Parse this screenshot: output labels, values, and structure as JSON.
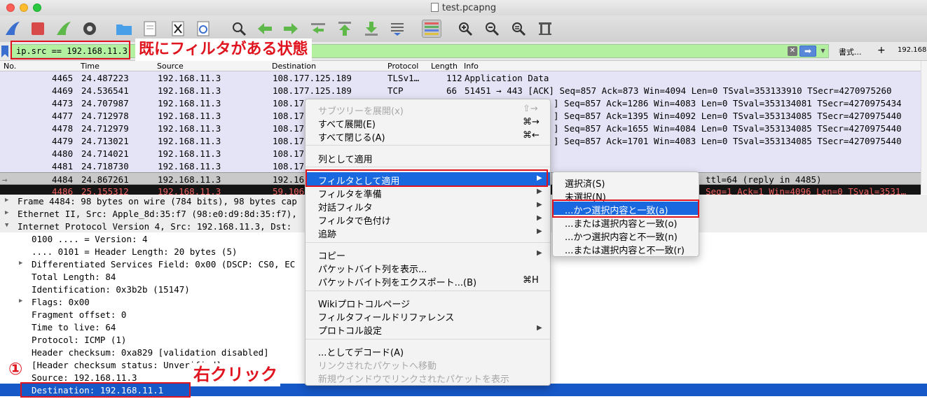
{
  "window": {
    "title": "test.pcapng"
  },
  "filter": {
    "value": "ip.src == 192.168.11.3",
    "format_label": "書式...",
    "add_label": "+",
    "address_label": "192.168."
  },
  "annotations": {
    "filter_note": "既にフィルタがある状態",
    "right_click_note": "右クリック",
    "step_number": "①"
  },
  "columns": [
    "No.",
    "Time",
    "Source",
    "Destination",
    "Protocol",
    "Length",
    "Info"
  ],
  "packets": [
    {
      "no": "4465",
      "time": "24.487223",
      "src": "192.168.11.3",
      "dst": "108.177.125.189",
      "proto": "TLSv1…",
      "len": "112",
      "info": "Application Data"
    },
    {
      "no": "4469",
      "time": "24.536541",
      "src": "192.168.11.3",
      "dst": "108.177.125.189",
      "proto": "TCP",
      "len": "66",
      "info": "51451 → 443 [ACK] Seq=857 Ack=873 Win=4094 Len=0 TSval=353133910 TSecr=4270975260"
    },
    {
      "no": "4473",
      "time": "24.707987",
      "src": "192.168.11.3",
      "dst": "108.17",
      "proto": "",
      "len": "",
      "info": "] Seq=857 Ack=1286 Win=4083 Len=0 TSval=353134081 TSecr=4270975434"
    },
    {
      "no": "4477",
      "time": "24.712978",
      "src": "192.168.11.3",
      "dst": "108.17",
      "proto": "",
      "len": "",
      "info": "] Seq=857 Ack=1395 Win=4092 Len=0 TSval=353134085 TSecr=4270975440"
    },
    {
      "no": "4478",
      "time": "24.712979",
      "src": "192.168.11.3",
      "dst": "108.17",
      "proto": "",
      "len": "",
      "info": "] Seq=857 Ack=1655 Win=4084 Len=0 TSval=353134085 TSecr=4270975440"
    },
    {
      "no": "4479",
      "time": "24.713021",
      "src": "192.168.11.3",
      "dst": "108.17",
      "proto": "",
      "len": "",
      "info": "] Seq=857 Ack=1701 Win=4083 Len=0 TSval=353134085 TSecr=4270975440"
    },
    {
      "no": "4480",
      "time": "24.714021",
      "src": "192.168.11.3",
      "dst": "108.17",
      "proto": "",
      "len": "",
      "info": ""
    },
    {
      "no": "4481",
      "time": "24.718730",
      "src": "192.168.11.3",
      "dst": "108.17",
      "proto": "",
      "len": "",
      "info": ""
    },
    {
      "no": "4484",
      "time": "24.867261",
      "src": "192.168.11.3",
      "dst": "192.16",
      "proto": "",
      "len": "",
      "info": "ttl=64 (reply in 4485)"
    },
    {
      "no": "4486",
      "time": "25.155312",
      "src": "192.168.11.3",
      "dst": "59.106",
      "proto": "",
      "len": "",
      "info": "Seq=1 Ack=1 Win=4096 Len=0 TSval=3531…"
    }
  ],
  "details": [
    {
      "arrow": "▶",
      "text": "Frame 4484: 98 bytes on wire (784 bits), 98 bytes cap"
    },
    {
      "arrow": "▶",
      "text": "Ethernet II, Src: Apple_8d:35:f7 (98:e0:d9:8d:35:f7),"
    },
    {
      "arrow": "▼",
      "text": "Internet Protocol Version 4, Src: 192.168.11.3, Dst:"
    },
    {
      "arrow": "",
      "text": "0100 .... = Version: 4"
    },
    {
      "arrow": "",
      "text": ".... 0101 = Header Length: 20 bytes (5)"
    },
    {
      "arrow": "▶",
      "text": "Differentiated Services Field: 0x00 (DSCP: CS0, EC"
    },
    {
      "arrow": "",
      "text": "Total Length: 84"
    },
    {
      "arrow": "",
      "text": "Identification: 0x3b2b (15147)"
    },
    {
      "arrow": "▶",
      "text": "Flags: 0x00"
    },
    {
      "arrow": "",
      "text": "Fragment offset: 0"
    },
    {
      "arrow": "",
      "text": "Time to live: 64"
    },
    {
      "arrow": "",
      "text": "Protocol: ICMP (1)"
    },
    {
      "arrow": "",
      "text": "Header checksum: 0xa829 [validation disabled]"
    },
    {
      "arrow": "",
      "text": "[Header checksum status: Unverified]"
    },
    {
      "arrow": "",
      "text": "Source: 192.168.11.3"
    },
    {
      "arrow": "",
      "text": "Destination: 192.168.11.1"
    }
  ],
  "context_menu": {
    "items": [
      {
        "label": "サブツリーを展開(x)",
        "shortcut": "⇧→"
      },
      {
        "label": "すべて展開(E)",
        "shortcut": "⌘→"
      },
      {
        "label": "すべて閉じる(A)",
        "shortcut": "⌘←"
      },
      {
        "label": "列として適用",
        "shortcut": ""
      },
      {
        "label": "フィルタとして適用",
        "shortcut": ""
      },
      {
        "label": "フィルタを準備",
        "shortcut": ""
      },
      {
        "label": "対話フィルタ",
        "shortcut": ""
      },
      {
        "label": "フィルタで色付け",
        "shortcut": ""
      },
      {
        "label": "追跡",
        "shortcut": ""
      },
      {
        "label": "コピー",
        "shortcut": ""
      },
      {
        "label": "パケットバイト列を表示...",
        "shortcut": ""
      },
      {
        "label": "パケットバイト列をエクスポート...(B)",
        "shortcut": "⌘H"
      },
      {
        "label": "Wikiプロトコルページ",
        "shortcut": ""
      },
      {
        "label": "フィルタフィールドリファレンス",
        "shortcut": ""
      },
      {
        "label": "プロトコル設定",
        "shortcut": ""
      },
      {
        "label": "...としてデコード(A)",
        "shortcut": ""
      },
      {
        "label": "リンクされたパケットへ移動",
        "shortcut": ""
      },
      {
        "label": "新規ウインドウでリンクされたパケットを表示",
        "shortcut": ""
      }
    ]
  },
  "submenu": {
    "items": [
      {
        "label": "選択済(S)"
      },
      {
        "label": "未選択(N)"
      },
      {
        "label": "...かつ選択内容と一致(a)"
      },
      {
        "label": "...または選択内容と一致(o)"
      },
      {
        "label": "...かつ選択内容と不一致(n)"
      },
      {
        "label": "...または選択内容と不一致(r)"
      }
    ]
  }
}
